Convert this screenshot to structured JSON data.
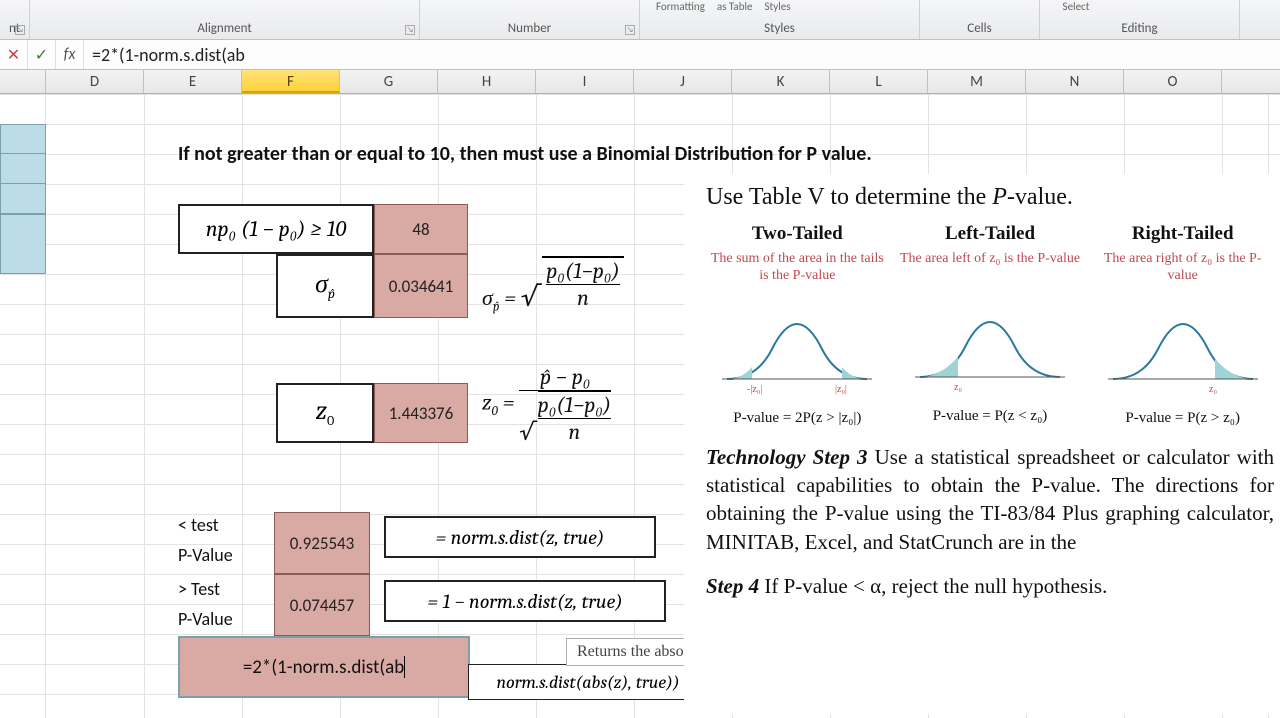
{
  "ribbon": {
    "groups": {
      "alignment": "Alignment",
      "number": "Number",
      "styles": "Styles",
      "cells": "Cells",
      "editing": "Editing"
    },
    "top": {
      "formatting": "Formatting",
      "astable": "as Table",
      "styles": "Styles",
      "select": "Select"
    }
  },
  "formula_bar": {
    "value": "=2*(1-norm.s.dist(ab"
  },
  "columns": [
    "D",
    "E",
    "F",
    "G",
    "H",
    "I",
    "J",
    "K",
    "L",
    "M",
    "N",
    "O"
  ],
  "active_column": "F",
  "headline": "If not greater than or equal to 10, then must use a Binomial Distribution for P value.",
  "cells": {
    "np_formula": "np₀ (1 − p₀) ≥ 10",
    "np_value": "48",
    "sigma_label": "σp̂",
    "sigma_value": "0.034641",
    "sigma_formula": "σp̂ = √( p₀(1−p₀) / n )",
    "z_label": "z₀",
    "z_value": "1.443376",
    "z_formula": "z₀ = ( p̂ − p₀ ) / √( p₀(1−p₀) / n )",
    "lt_label1": "< test",
    "lt_label2": "P-Value",
    "lt_value": "0.925543",
    "lt_formula": "= norm.s.dist(z, true)",
    "gt_label1": "> Test",
    "gt_label2": "P-Value",
    "gt_value": "0.074457",
    "gt_formula": "= 1 − norm.s.dist(z, true)",
    "editing_value": "=2*(1-norm.s.dist(ab",
    "two_formula": "norm.s.dist(abs(z), true))"
  },
  "tooltip": "Returns the absolute value of a number, a number without its sign",
  "overlay": {
    "title_pre": "Use Table V to determine the ",
    "title_em": "P",
    "title_post": "-value.",
    "cols": [
      {
        "h": "Two-Tailed",
        "desc": "The sum of the area in the tails is the P-value",
        "pv": "P-value = 2P(z > |z₀|)"
      },
      {
        "h": "Left-Tailed",
        "desc": "The area left of z₀ is the P-value",
        "pv": "P-value = P(z < z₀)"
      },
      {
        "h": "Right-Tailed",
        "desc": "The area right of z₀ is the P-value",
        "pv": "P-value = P(z > z₀)"
      }
    ],
    "tech_lead": "Technology Step 3",
    "tech_body": "  Use a statistical spreadsheet or calculator with statistical capabilities to obtain the P-value. The directions for obtaining the P-value using the TI-83/84 Plus graphing calculator, MINITAB, Excel, and StatCrunch are in the",
    "step4_lead": "Step 4",
    "step4_body": "  If P-value < α, reject the null hypothesis."
  }
}
